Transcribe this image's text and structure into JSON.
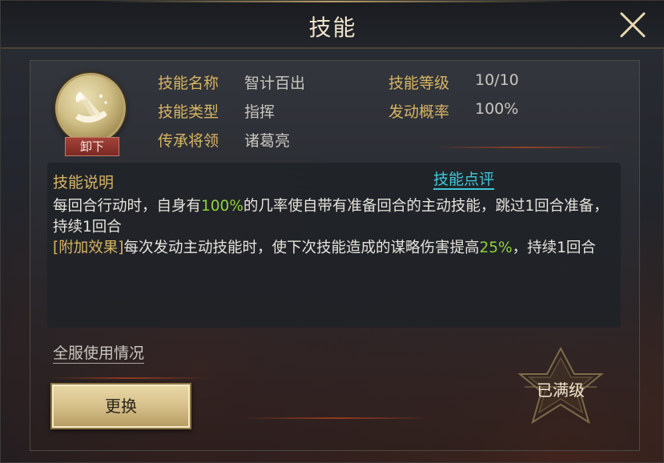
{
  "dialog": {
    "title": "技能",
    "close_icon": "close-icon"
  },
  "skill": {
    "icon": "scroll-quill-icon",
    "unequip_label": "卸下",
    "name_label": "技能名称",
    "name_value": "智计百出",
    "type_label": "技能类型",
    "type_value": "指挥",
    "inherit_label": "传承将领",
    "inherit_value": "诸葛亮",
    "level_label": "技能等级",
    "level_value": "10/10",
    "trigger_label": "发动概率",
    "trigger_value": "100%"
  },
  "description": {
    "title": "技能说明",
    "review_link": "技能点评",
    "line1_a": "每回合行动时，自身有",
    "line1_hl": "100%",
    "line1_b": "的几率使自带有准备回合的主动技能，跳过1回合准备，持续1回合",
    "bonus_tag": "[附加效果]",
    "line2_a": "每次发动主动技能时，使下次技能造成的谋略伤害提高",
    "line2_hl": "25%",
    "line2_b": "，持续1回合"
  },
  "footer": {
    "server_usage_link": "全服使用情况",
    "change_button": "更换",
    "max_level_text": "已满级"
  },
  "colors": {
    "label_gold": "#d7b463",
    "highlight_green": "#8fd23e",
    "link_cyan": "#41c7d6",
    "unequip_red": "#8f332d"
  }
}
